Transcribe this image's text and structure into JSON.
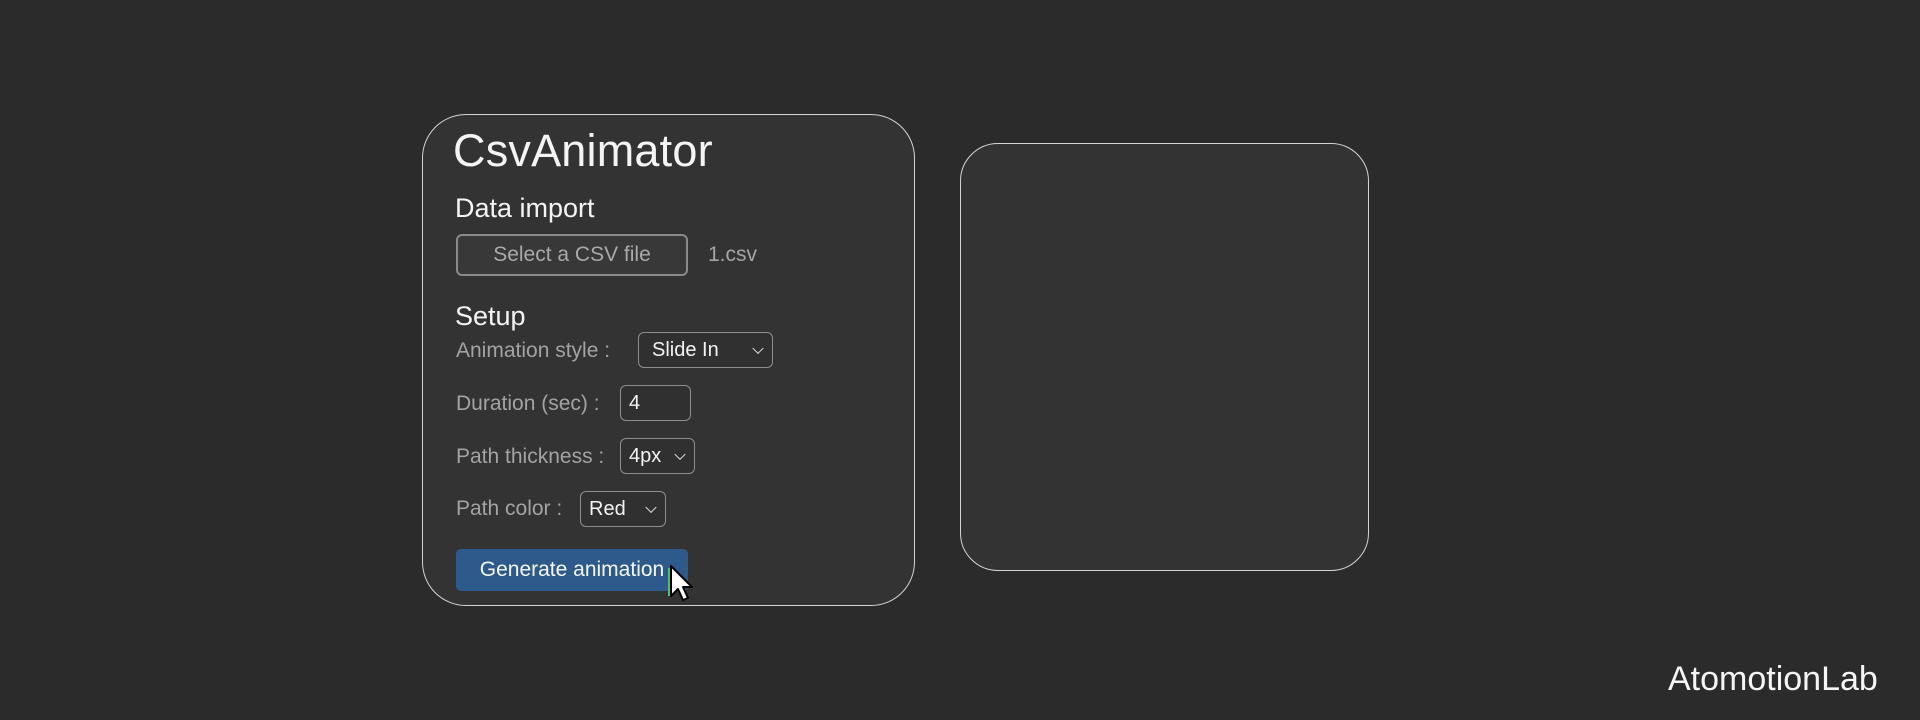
{
  "app": {
    "title": "CsvAnimator"
  },
  "data_import": {
    "heading": "Data import",
    "select_button_label": "Select a CSV file",
    "file_name": "1.csv"
  },
  "setup": {
    "heading": "Setup",
    "animation_style": {
      "label": "Animation style :",
      "selected": "Slide In"
    },
    "duration": {
      "label": "Duration (sec) :",
      "value": "4"
    },
    "path_thickness": {
      "label": "Path thickness :",
      "selected": "4px"
    },
    "path_color": {
      "label": "Path color :",
      "selected": "Red"
    }
  },
  "generate_button_label": "Generate animation",
  "preview": {},
  "watermark": "AtomotionLab",
  "colors": {
    "background": "#2b2b2b",
    "card": "#333333",
    "card_border": "#d4d4d4",
    "primary_button": "#2d5a8a"
  },
  "icons": {
    "cursor": "pointer-arrow-icon",
    "dropdown": "chevron-down-icon"
  }
}
